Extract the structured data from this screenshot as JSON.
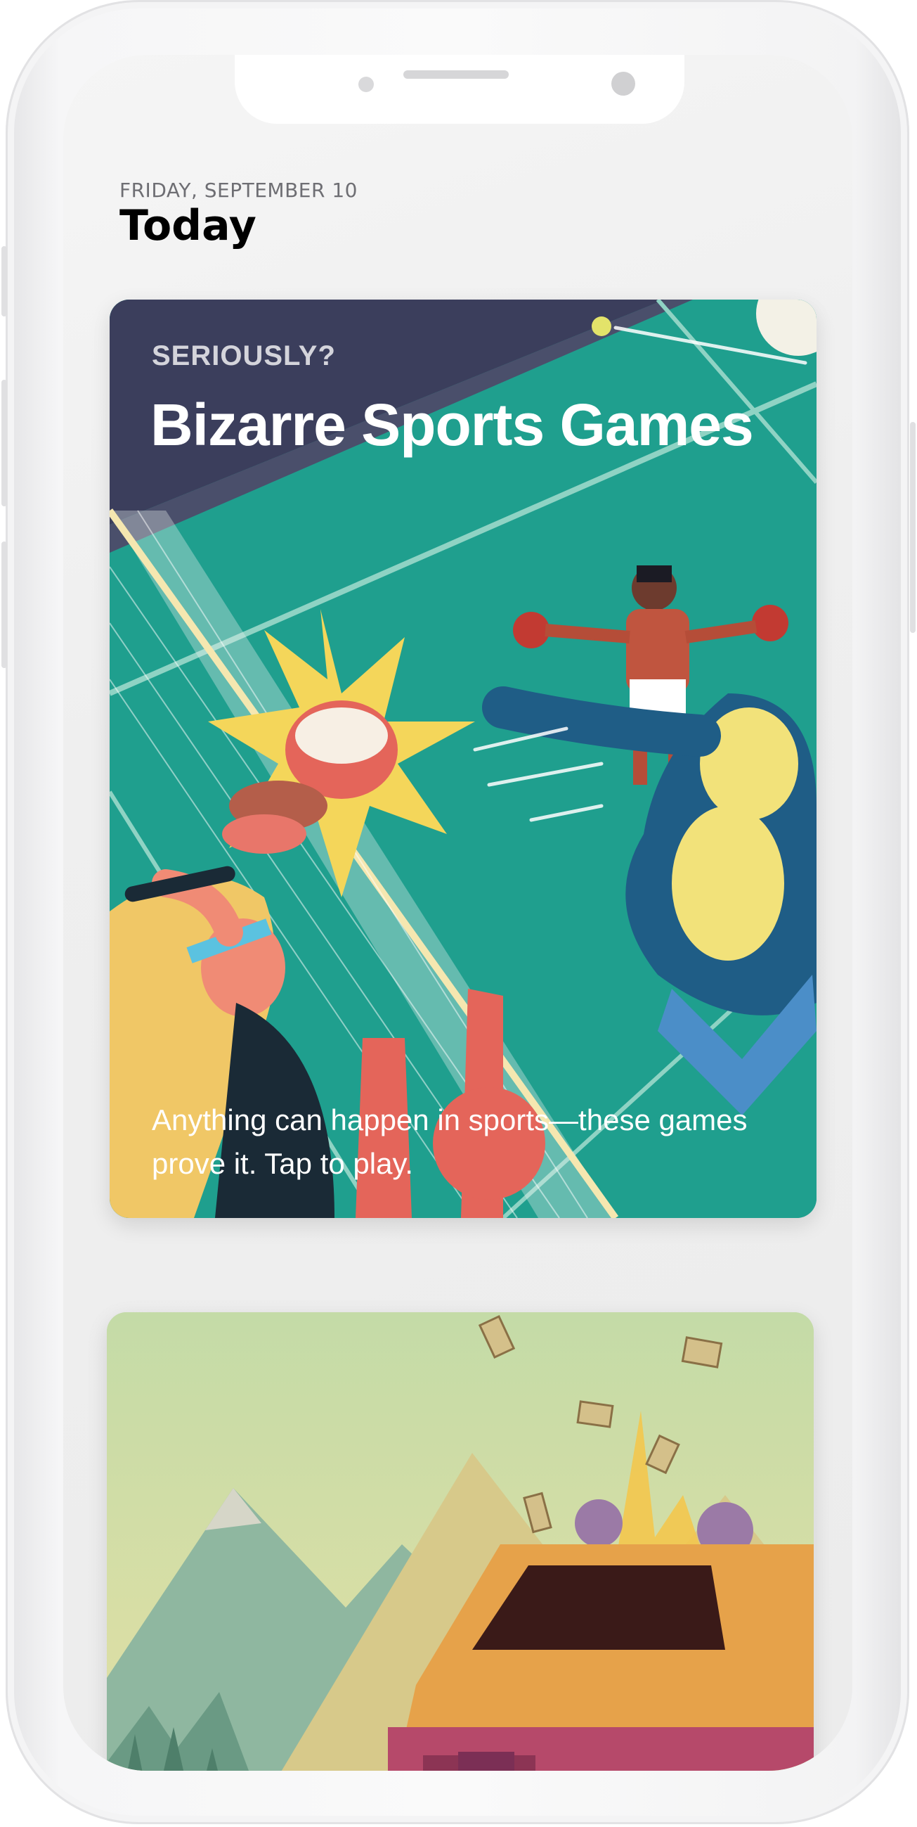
{
  "status": {
    "date": "FRIDAY, SEPTEMBER 10",
    "title": "Today"
  },
  "cards": [
    {
      "eyebrow": "SERIOUSLY?",
      "title": "Bizarre Sports Games",
      "subtitle": "Anything can happen in sports—these games prove it. Tap to play.",
      "artwork": "sports-illustration"
    },
    {
      "artwork": "mountain-van-illustration"
    }
  ],
  "colors": {
    "card1_background": "#1f9f8e",
    "card1_sky": "#3b3e5c",
    "card2_sky": "#bcd8a6",
    "title_text": "#000000",
    "date_text": "#6e6e73"
  }
}
